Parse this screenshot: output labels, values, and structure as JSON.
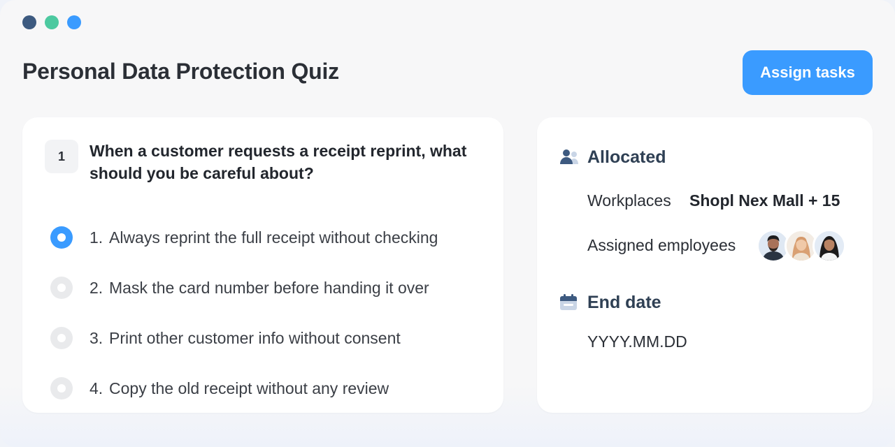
{
  "window": {
    "dots": [
      {
        "name": "dot-close",
        "color": "#3d5a80"
      },
      {
        "name": "dot-minimize",
        "color": "#4cc9a0"
      },
      {
        "name": "dot-maximize",
        "color": "#3a9bff"
      }
    ]
  },
  "header": {
    "title": "Personal Data Protection Quiz",
    "assign_button": "Assign tasks",
    "accent_color": "#3a9bff"
  },
  "quiz": {
    "number": "1",
    "question": "When a customer requests a receipt reprint, what should you be careful about?",
    "options": [
      {
        "num": "1.",
        "label": "Always reprint the full receipt without checking",
        "selected": true
      },
      {
        "num": "2.",
        "label": "Mask the card number before handing it over",
        "selected": false
      },
      {
        "num": "3.",
        "label": "Print other customer info without consent",
        "selected": false
      },
      {
        "num": "4.",
        "label": "Copy the old receipt without any review",
        "selected": false
      }
    ]
  },
  "info": {
    "allocated_title": "Allocated",
    "allocated_icon": "people-icon",
    "workplaces_label": "Workplaces",
    "workplaces_value": "Shopl Nex Mall + 15",
    "employees_label": "Assigned employees",
    "end_date_title": "End date",
    "end_date_icon": "calendar-icon",
    "end_date_value": "YYYY.MM.DD"
  }
}
